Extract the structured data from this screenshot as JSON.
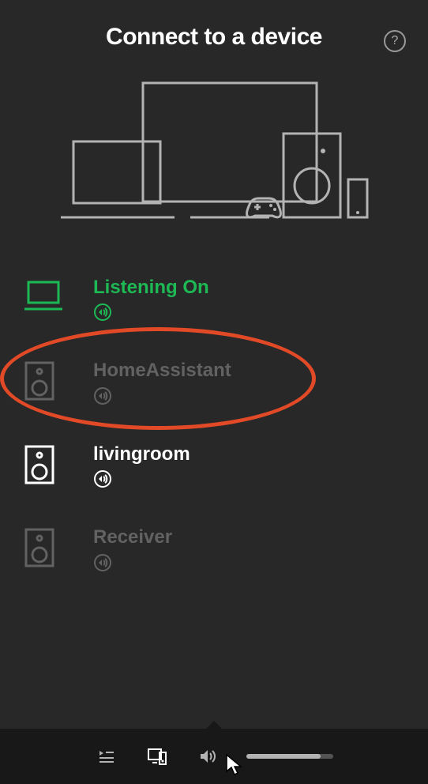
{
  "header": {
    "title": "Connect to a device",
    "help_tooltip": "?"
  },
  "devices": [
    {
      "name": "Listening On",
      "state": "active",
      "icon": "laptop"
    },
    {
      "name": "HomeAssistant",
      "state": "dim",
      "icon": "speaker"
    },
    {
      "name": "livingroom",
      "state": "avail",
      "icon": "speaker"
    },
    {
      "name": "Receiver",
      "state": "dim",
      "icon": "speaker"
    }
  ],
  "annotation": {
    "device_index": 1,
    "color": "#e24a27"
  },
  "player": {
    "volume_percent": 85
  }
}
